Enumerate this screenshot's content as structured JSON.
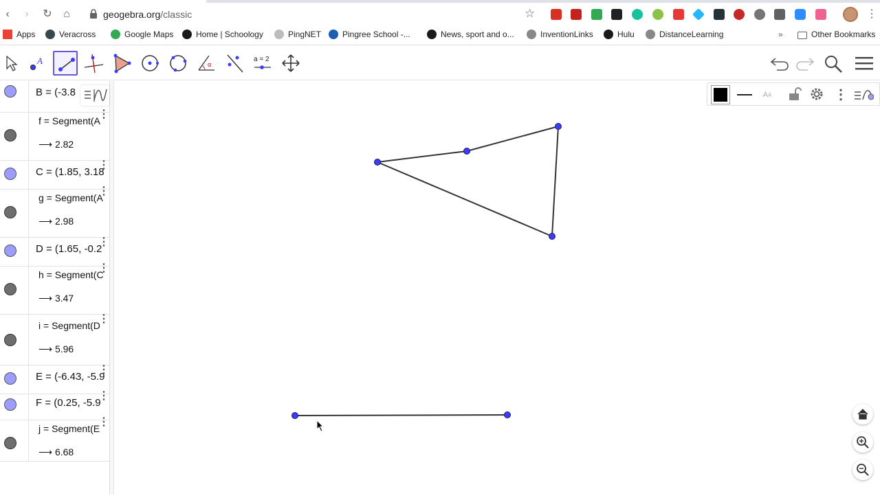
{
  "browser": {
    "url_host": "geogebra.org",
    "url_path": "/classic",
    "bookmarks": [
      {
        "label": "Apps",
        "color": "#ea4335"
      },
      {
        "label": "Veracross",
        "color": "#37474f"
      },
      {
        "label": "Google Maps",
        "color": "#34a853"
      },
      {
        "label": "Home | Schoology",
        "color": "#1a1a1a"
      },
      {
        "label": "PingNET",
        "color": "#bdbdbd"
      },
      {
        "label": "Pingree School -...",
        "color": "#1a5fb4"
      },
      {
        "label": "News, sport and o...",
        "color": "#1a1a1a"
      },
      {
        "label": "InventionLinks",
        "color": "#888888"
      },
      {
        "label": "Hulu",
        "color": "#1a1a1a"
      },
      {
        "label": "DistanceLearning",
        "color": "#888888"
      }
    ],
    "more_bookmarks": "»",
    "other_bookmarks": "Other Bookmarks"
  },
  "toolbar": {
    "accent": "#6557d2",
    "tools": [
      {
        "name": "move-tool-icon"
      },
      {
        "name": "point-tool-icon"
      },
      {
        "name": "segment-tool-icon",
        "active": true
      },
      {
        "name": "perpendicular-line-tool-icon"
      },
      {
        "name": "polygon-tool-icon"
      },
      {
        "name": "circle-center-point-tool-icon"
      },
      {
        "name": "circle-three-points-tool-icon"
      },
      {
        "name": "angle-tool-icon"
      },
      {
        "name": "reflect-tool-icon"
      },
      {
        "name": "slider-tool-icon",
        "label": "a = 2"
      },
      {
        "name": "move-graphics-tool-icon"
      }
    ]
  },
  "algebra": {
    "rows": [
      {
        "marble": "blue",
        "def": "B = (-3.8",
        "value": null
      },
      {
        "marble": "grey",
        "def": "f = Segment(A",
        "value": "⟶ 2.82"
      },
      {
        "marble": "blue",
        "def": "C = (1.85, 3.18",
        "value": null
      },
      {
        "marble": "grey",
        "def": "g = Segment(A",
        "value": "⟶ 2.98"
      },
      {
        "marble": "blue",
        "def": "D = (1.65, -0.2",
        "value": null
      },
      {
        "marble": "grey",
        "def": "h = Segment(C",
        "value": "⟶ 3.47"
      },
      {
        "marble": "grey",
        "def": "i = Segment(D",
        "value": "⟶ 5.96"
      },
      {
        "marble": "blue",
        "def": "E = (-6.43, -5.9",
        "value": null
      },
      {
        "marble": "blue",
        "def": "F = (0.25, -5.9",
        "value": null
      },
      {
        "marble": "grey",
        "def": "j = Segment(E",
        "value": "⟶ 6.68"
      }
    ]
  },
  "graphics": {
    "point_color": "#3c3cff",
    "segment_color": "#333333"
  }
}
